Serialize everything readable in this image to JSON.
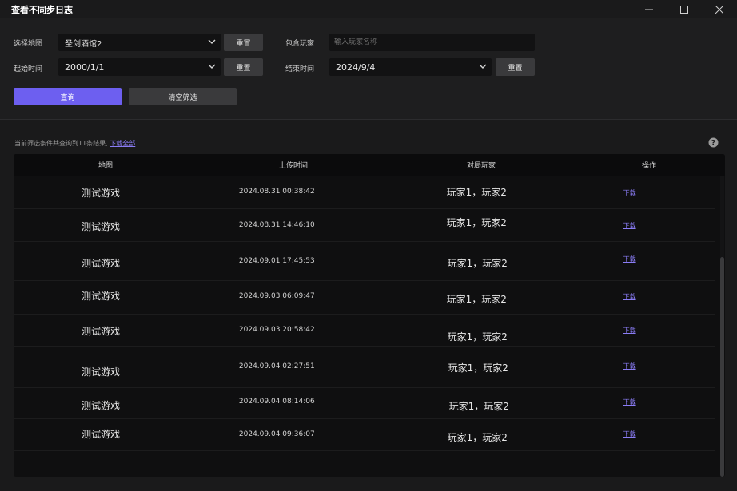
{
  "window": {
    "title": "查看不同步日志"
  },
  "filters": {
    "map_label": "选择地图",
    "map_value": "圣剑酒馆2",
    "reset_label": "重置",
    "player_label": "包含玩家",
    "player_placeholder": "输入玩家名称",
    "start_label": "起始时间",
    "start_value": "2000/1/1",
    "end_label": "结束时间",
    "end_value": "2024/9/4",
    "query_label": "查询",
    "clear_label": "清空筛选"
  },
  "summary": {
    "text": "当前筛选条件共查询到11条结果,",
    "download_all": "下载全部"
  },
  "table": {
    "headers": [
      "地图",
      "上传时间",
      "对局玩家",
      "操作"
    ],
    "rows": [
      {
        "map": "测试游戏",
        "time": "2024.08.31 00:38:42",
        "players": "玩家1，玩家2",
        "action": "下载"
      },
      {
        "map": "测试游戏",
        "time": "2024.08.31 14:46:10",
        "players": "玩家1，玩家2",
        "action": "下载"
      },
      {
        "map": "测试游戏",
        "time": "2024.09.01 17:45:53",
        "players": "玩家1，玩家2",
        "action": "下载"
      },
      {
        "map": "测试游戏",
        "time": "2024.09.03 06:09:47",
        "players": "玩家1，玩家2",
        "action": "下载"
      },
      {
        "map": "测试游戏",
        "time": "2024.09.03 20:58:42",
        "players": "玩家1，玩家2",
        "action": "下载"
      },
      {
        "map": "测试游戏",
        "time": "2024.09.04 02:27:51",
        "players": "玩家1，玩家2",
        "action": "下载"
      },
      {
        "map": "测试游戏",
        "time": "2024.09.04 08:14:06",
        "players": "玩家1，玩家2",
        "action": "下载"
      },
      {
        "map": "测试游戏",
        "time": "2024.09.04 09:36:07",
        "players": "玩家1，玩家2",
        "action": "下载"
      }
    ]
  },
  "colors": {
    "accent": "#6d5ff0",
    "link": "#8a7cf5",
    "background": "#1a1a1b"
  },
  "icons": [
    "minimize-icon",
    "maximize-icon",
    "close-icon",
    "chevron-down-icon",
    "help-icon"
  ]
}
